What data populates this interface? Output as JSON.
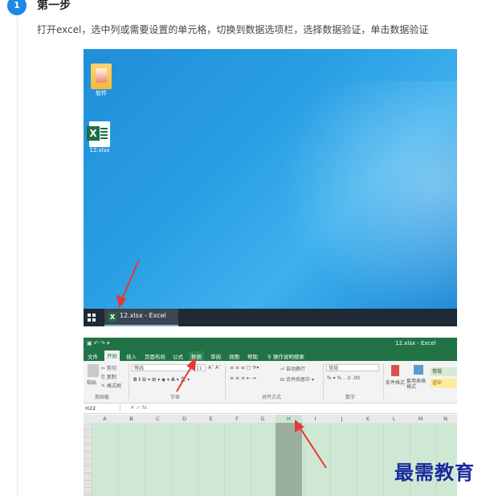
{
  "step": {
    "number": "1",
    "title": "第一步",
    "description": "打开excel，选中列或需要设置的单元格，切换到数据选项栏，选择数据验证，单击数据验证"
  },
  "desktop": {
    "icons": [
      {
        "label": "软件",
        "icon": "folder-icon"
      },
      {
        "label": "12.xlsx",
        "icon": "excel-file-icon"
      }
    ],
    "taskbar_item": "12.xlsx - Excel",
    "accent_color": "#2196f3"
  },
  "excel": {
    "window_title": "12.xlsx - Excel",
    "tabs": [
      "文件",
      "开始",
      "插入",
      "页面布局",
      "公式",
      "数据",
      "审阅",
      "视图",
      "帮助",
      "操作说明搜索"
    ],
    "active_tab": "开始",
    "highlighted_tab": "数据",
    "ribbon": {
      "clipboard": {
        "cut": "剪切",
        "copy": "复制",
        "format_painter": "格式刷",
        "paste": "粘贴",
        "group": "剪贴板"
      },
      "font": {
        "name": "等线",
        "size": "11",
        "group": "字体"
      },
      "alignment": {
        "wrap": "自动换行",
        "merge": "合并后居中",
        "group": "对齐方式"
      },
      "number": {
        "format": "常规",
        "group": "数字"
      },
      "styles": {
        "conditional": "条件格式",
        "table": "套用表格格式",
        "normal": "常规",
        "neutral": "适中"
      }
    },
    "name_box": "H22",
    "fx_label": "fx",
    "columns": [
      "A",
      "B",
      "C",
      "D",
      "E",
      "F",
      "G",
      "H",
      "I",
      "J",
      "K",
      "L",
      "M",
      "N"
    ],
    "selected_column": "H",
    "brand_color": "#217346"
  },
  "watermark": "最需教育"
}
